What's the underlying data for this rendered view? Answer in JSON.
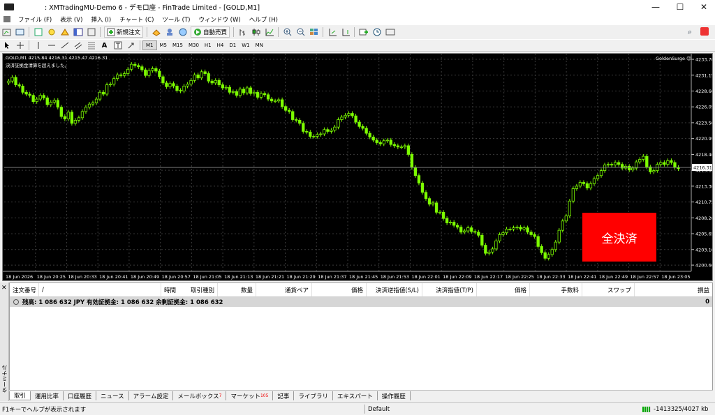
{
  "window": {
    "title": ": XMTradingMU-Demo 6 - デモ口座 - FinTrade Limited - [GOLD,M1]",
    "controls": [
      "—",
      "☐",
      "✕"
    ]
  },
  "menu": {
    "items": [
      "ファイル (F)",
      "表示 (V)",
      "挿入 (I)",
      "チャート (C)",
      "ツール (T)",
      "ウィンドウ (W)",
      "ヘルプ (H)"
    ]
  },
  "toolbar": {
    "new_order_label": "新規注文",
    "autotrade_label": "自動売買",
    "timeframes": [
      "M1",
      "M5",
      "M15",
      "M30",
      "H1",
      "H4",
      "D1",
      "W1",
      "MN"
    ],
    "active_timeframe": "M1"
  },
  "chart": {
    "header": "GOLD,M1  4215.84 4216.31 4215.47 4216.31",
    "warning": "決済証拠金清算を超えました。",
    "ea_name": "GoldenSurge",
    "close_all_label": "全決済",
    "current_price_label": "4216.31",
    "colors": {
      "background": "#000000",
      "candle": "#7cfc00",
      "grid": "#3a3a3a",
      "button": "#ff0000"
    }
  },
  "chart_data": {
    "type": "candlestick",
    "symbol": "GOLD",
    "timeframe": "M1",
    "ylim": [
      4199.6,
      4234.6
    ],
    "y_ticks": [
      "4233.70",
      "4231.15",
      "4228.60",
      "4226.05",
      "4223.50",
      "4220.95",
      "4218.40",
      "4215.85",
      "4213.30",
      "4210.75",
      "4208.20",
      "4205.65",
      "4203.10",
      "4200.60"
    ],
    "x_ticks": [
      "18 Jun 2026",
      "18 Jun 20:25",
      "18 Jun 20:33",
      "18 Jun 20:41",
      "18 Jun 20:49",
      "18 Jun 20:57",
      "18 Jun 21:05",
      "18 Jun 21:13",
      "18 Jun 21:21",
      "18 Jun 21:29",
      "18 Jun 21:37",
      "18 Jun 21:45",
      "18 Jun 21:53",
      "18 Jun 22:01",
      "18 Jun 22:09",
      "18 Jun 22:17",
      "18 Jun 22:25",
      "18 Jun 22:33",
      "18 Jun 22:41",
      "18 Jun 22:49",
      "18 Jun 22:57",
      "18 Jun 23:05"
    ],
    "closes": [
      4230.2,
      4230.8,
      4229.6,
      4229.4,
      4228.4,
      4228.1,
      4227.9,
      4226.9,
      4227.3,
      4227.9,
      4227.5,
      4226.4,
      4226.8,
      4227.1,
      4226.0,
      4224.5,
      4224.1,
      4225.2,
      4223.4,
      4223.9,
      4224.3,
      4225.3,
      4226.0,
      4226.5,
      4226.7,
      4227.3,
      4228.4,
      4228.1,
      4229.6,
      4229.7,
      4230.6,
      4231.2,
      4231.1,
      4231.4,
      4232.1,
      4232.9,
      4232.7,
      4232.5,
      4232.0,
      4231.1,
      4231.9,
      4232.2,
      4231.8,
      4230.9,
      4229.9,
      4229.3,
      4229.8,
      4229.4,
      4228.7,
      4228.6,
      4229.4,
      4229.7,
      4230.3,
      4231.2,
      4230.7,
      4231.7,
      4231.4,
      4230.2,
      4229.9,
      4230.3,
      4229.6,
      4229.1,
      4229.2,
      4228.4,
      4228.5,
      4227.9,
      4228.9,
      4228.3,
      4229.1,
      4228.2,
      4228.4,
      4227.6,
      4228.2,
      4228.0,
      4227.3,
      4227.0,
      4227.0,
      4227.2,
      4226.1,
      4225.5,
      4225.3,
      4224.0,
      4223.9,
      4223.4,
      4222.1,
      4222.0,
      4221.3,
      4221.3,
      4221.6,
      4221.7,
      4222.4,
      4222.1,
      4222.3,
      4222.8,
      4224.0,
      4224.4,
      4224.7,
      4225.0,
      4224.6,
      4223.6,
      4222.9,
      4222.6,
      4221.8,
      4221.2,
      4220.7,
      4220.3,
      4220.1,
      4220.6,
      4220.7,
      4220.0,
      4219.8,
      4219.6,
      4219.6,
      4219.8,
      4218.4,
      4216.3,
      4215.0,
      4213.8,
      4212.3,
      4211.3,
      4210.4,
      4210.6,
      4209.1,
      4209.1,
      4208.1,
      4207.4,
      4207.5,
      4207.0,
      4206.7,
      4205.9,
      4206.1,
      4206.6,
      4206.0,
      4205.9,
      4205.4,
      4203.8,
      4202.5,
      4202.7,
      4203.2,
      4204.5,
      4205.5,
      4205.8,
      4206.4,
      4206.4,
      4206.6,
      4206.7,
      4206.4,
      4206.6,
      4205.9,
      4205.5,
      4205.2,
      4203.6,
      4202.6,
      4201.7,
      4202.3,
      4203.1,
      4204.3,
      4206.2,
      4207.7,
      4208.5,
      4210.9,
      4212.9,
      4213.3,
      4213.9,
      4213.7,
      4213.0,
      4213.7,
      4214.5,
      4215.0,
      4215.8,
      4216.7,
      4216.8,
      4216.7,
      4217.1,
      4216.8,
      4216.2,
      4216.5,
      4215.9,
      4216.2,
      4217.2,
      4217.6,
      4218.1,
      4216.4,
      4215.6,
      4215.8,
      4216.8,
      4217.1,
      4216.8,
      4217.4,
      4217.1,
      4216.3,
      4216.1
    ]
  },
  "terminal": {
    "tab_label": "ターミナル",
    "columns": [
      "注文番号",
      "/",
      "時間",
      "取引種別",
      "数量",
      "通貨ペア",
      "価格",
      "決済逆指値(S/L)",
      "決済指値(T/P)",
      "価格",
      "手数料",
      "スワップ",
      "損益"
    ],
    "balance_text": "残高: 1 086 632 JPY  有効証拠金: 1 086 632  余剰証拠金: 1 086 632",
    "balance_total": "0",
    "tabs": [
      {
        "label": "取引"
      },
      {
        "label": "運用比率"
      },
      {
        "label": "口座履歴"
      },
      {
        "label": "ニュース"
      },
      {
        "label": "アラーム設定"
      },
      {
        "label": "メールボックス",
        "badge": "7"
      },
      {
        "label": "マーケット",
        "badge": "105"
      },
      {
        "label": "記事"
      },
      {
        "label": "ライブラリ"
      },
      {
        "label": "エキスパート"
      },
      {
        "label": "操作履歴"
      }
    ]
  },
  "status": {
    "help": "F1キーでヘルプが表示されます",
    "profile": "Default",
    "connection": "-1413325/4027 kb"
  }
}
